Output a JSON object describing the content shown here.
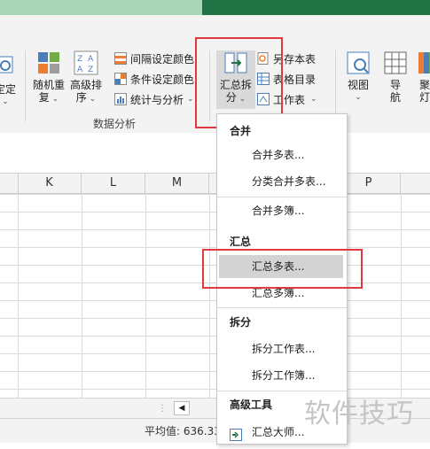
{
  "ribbon": {
    "left_cut_label": "定定",
    "random_repeat": {
      "line1": "随机重",
      "line2": "复"
    },
    "advanced_sort": {
      "line1": "高级排",
      "line2": "序"
    },
    "interval_color": "间隔设定颜色",
    "conditional_color": "条件设定颜色",
    "stats_analysis": "统计与分析",
    "group_label": "数据分析",
    "summarize_split": {
      "line1": "汇总拆",
      "line2": "分"
    },
    "save_as_table": "另存本表",
    "table_directory": "表格目录",
    "worksheet": "工作表",
    "view": {
      "line1": "视图"
    },
    "nav": {
      "line1": "导",
      "line2": "航"
    },
    "cut_right": {
      "line1": "聚",
      "line2": "灯"
    }
  },
  "columns": [
    "K",
    "L",
    "M",
    "P"
  ],
  "status": {
    "average_label": "平均值: 636.33"
  },
  "menu": {
    "sections": {
      "merge": "合并",
      "summarize": "汇总",
      "split": "拆分",
      "advanced": "高级工具"
    },
    "items": {
      "merge_multi_tables": "合并多表...",
      "category_merge_multi_tables": "分类合并多表...",
      "merge_multi_books": "合并多簿...",
      "summarize_multi_tables": "汇总多表...",
      "summarize_multi_books": "汇总多簿...",
      "split_worksheet_table": "拆分工作表...",
      "split_worksheet_book": "拆分工作簿...",
      "summary_master": "汇总大师..."
    }
  },
  "watermark": "软件技巧",
  "colors": {
    "accent_green": "#217346",
    "highlight_red": "#e0393e"
  }
}
